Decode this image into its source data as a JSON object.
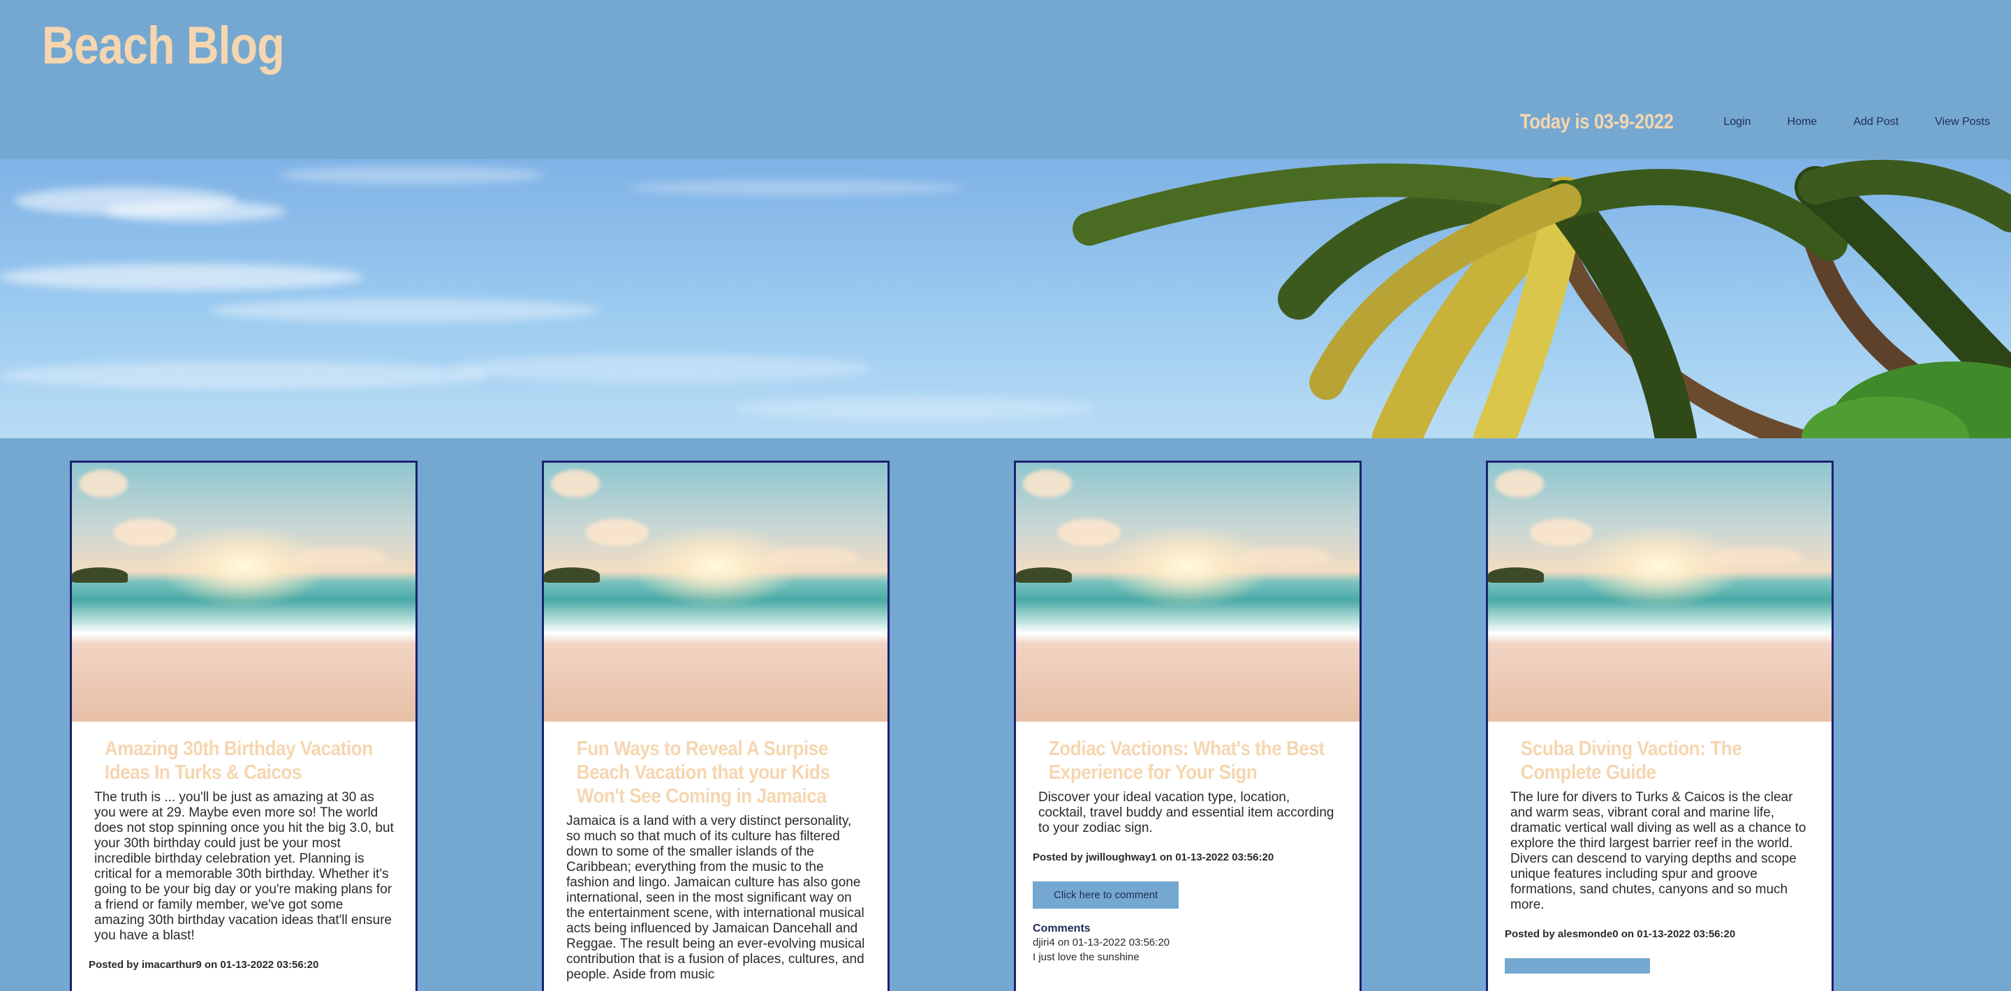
{
  "site": {
    "brand": "Beach Blog",
    "today": "Today is 03-9-2022"
  },
  "nav": [
    {
      "label": "Login"
    },
    {
      "label": "Home"
    },
    {
      "label": "Add Post"
    },
    {
      "label": "View Posts"
    }
  ],
  "colors": {
    "page_bg": "#75a8d0",
    "accent_text": "#f5d6b0",
    "card_border": "#1c2170",
    "nav_text": "#1e2d54"
  },
  "posts": [
    {
      "title": "Amazing 30th Birthday Vacation Ideas In Turks & Caicos",
      "body": "The truth is ... you'll be just as amazing at 30 as you were at 29. Maybe even more so! The world does not stop spinning once you hit the big 3.0, but your 30th birthday could just be your most incredible birthday celebration yet. Planning is critical for a memorable 30th birthday. Whether it's going to be your big day or you're making plans for a friend or family member, we've got some amazing 30th birthday vacation ideas that'll ensure you have a blast!",
      "posted_by": "imacarthur9",
      "posted_on": "01-13-2022 03:56:20"
    },
    {
      "title": "Fun Ways to Reveal A Surpise Beach Vacation that your Kids Won't See Coming in Jamaica",
      "body": "Jamaica is a land with a very distinct personality, so much so that much of its culture has filtered down to some of the smaller islands of the Caribbean; everything from the music to the fashion and lingo. Jamaican culture has also gone international, seen in the most significant way on the entertainment scene, with international musical acts being influenced by Jamaican Dancehall and Reggae. The result being an ever-evolving musical contribution that is a fusion of places, cultures, and people. Aside from music",
      "posted_by": "",
      "posted_on": ""
    },
    {
      "title": "Zodiac Vactions: What's the Best Experience for Your Sign",
      "body": "Discover your ideal vacation type, location, cocktail, travel buddy and essential item according to your zodiac sign.",
      "posted_by": "jwilloughway1",
      "posted_on": "01-13-2022 03:56:20",
      "comment_button": "Click here to comment",
      "comments_heading": "Comments",
      "comments": [
        {
          "author": "djiri4",
          "date": "01-13-2022 03:56:20",
          "text": "I just love the sunshine"
        }
      ]
    },
    {
      "title": "Scuba Diving Vaction: The Complete Guide",
      "body": "The lure for divers to Turks & Caicos is the clear and warm seas, vibrant coral and marine life, dramatic vertical wall diving as well as a chance to explore the third largest barrier reef in the world. Divers can descend to varying depths and scope unique features including spur and groove formations, sand chutes, canyons and so much more.",
      "posted_by": "alesmonde0",
      "posted_on": "01-13-2022 03:56:20",
      "comment_button": ""
    }
  ],
  "labels": {
    "posted_by": "Posted by",
    "on": "on"
  }
}
